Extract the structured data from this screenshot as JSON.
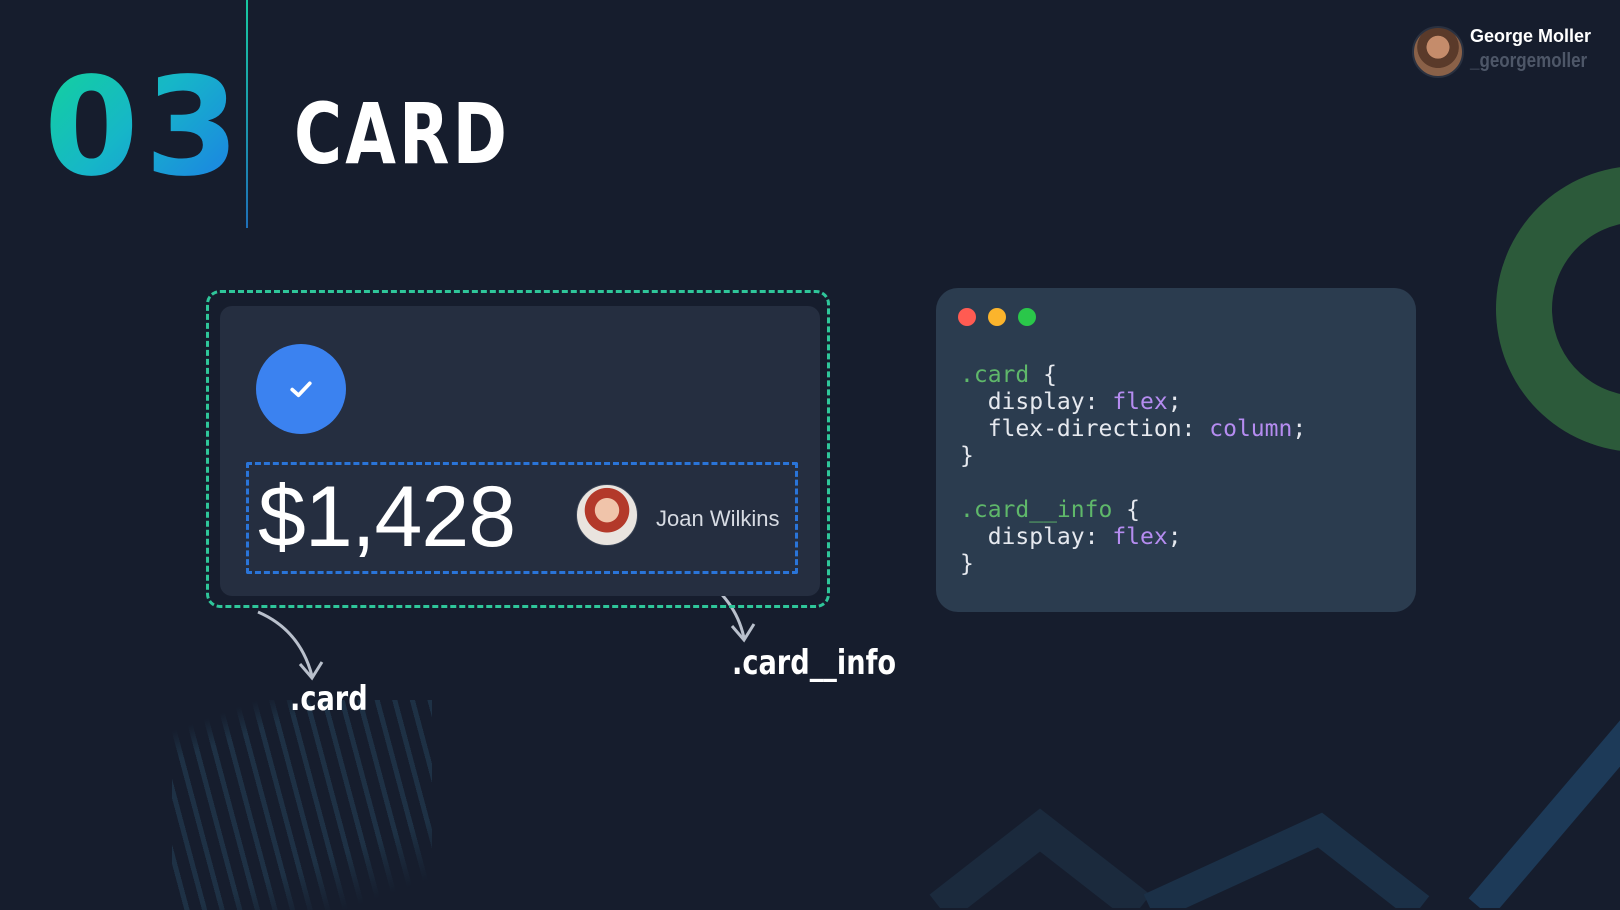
{
  "slide": {
    "number": "03",
    "title": "CARD"
  },
  "author": {
    "name": "George Moller",
    "handle": "_georgemoller"
  },
  "card_demo": {
    "amount": "$1,428",
    "person_name": "Joan Wilkins",
    "label_card": ".card",
    "label_info": ".card__info"
  },
  "code": {
    "rule1": {
      "selector": ".card",
      "open": " {",
      "close": "}",
      "decl1_prop": "  display: ",
      "decl1_val": "flex",
      "decl1_end": ";",
      "decl2_prop": "  flex-direction: ",
      "decl2_val": "column",
      "decl2_end": ";"
    },
    "rule2": {
      "selector": ".card__info",
      "open": " {",
      "close": "}",
      "decl1_prop": "  display: ",
      "decl1_val": "flex",
      "decl1_end": ";"
    }
  },
  "colors": {
    "background": "#161d2d",
    "accent_green": "#2fc69a",
    "accent_blue": "#3b82f0",
    "code_selector": "#5fb86a",
    "code_value": "#b58cf0"
  },
  "icons": [
    "check-icon",
    "author-avatar",
    "person-avatar",
    "arrow-icon"
  ]
}
